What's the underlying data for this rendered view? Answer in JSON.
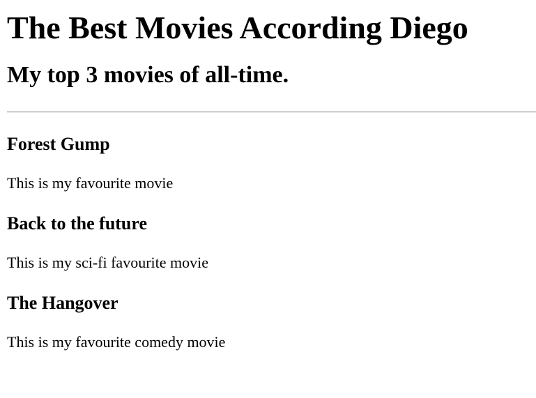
{
  "header": {
    "title": "The Best Movies According Diego",
    "subtitle": "My top 3 movies of all-time."
  },
  "movies": [
    {
      "title": "Forest Gump",
      "description": "This is my favourite movie"
    },
    {
      "title": "Back to the future",
      "description": "This is my sci-fi favourite movie"
    },
    {
      "title": "The Hangover",
      "description": "This is my favourite comedy movie"
    }
  ]
}
